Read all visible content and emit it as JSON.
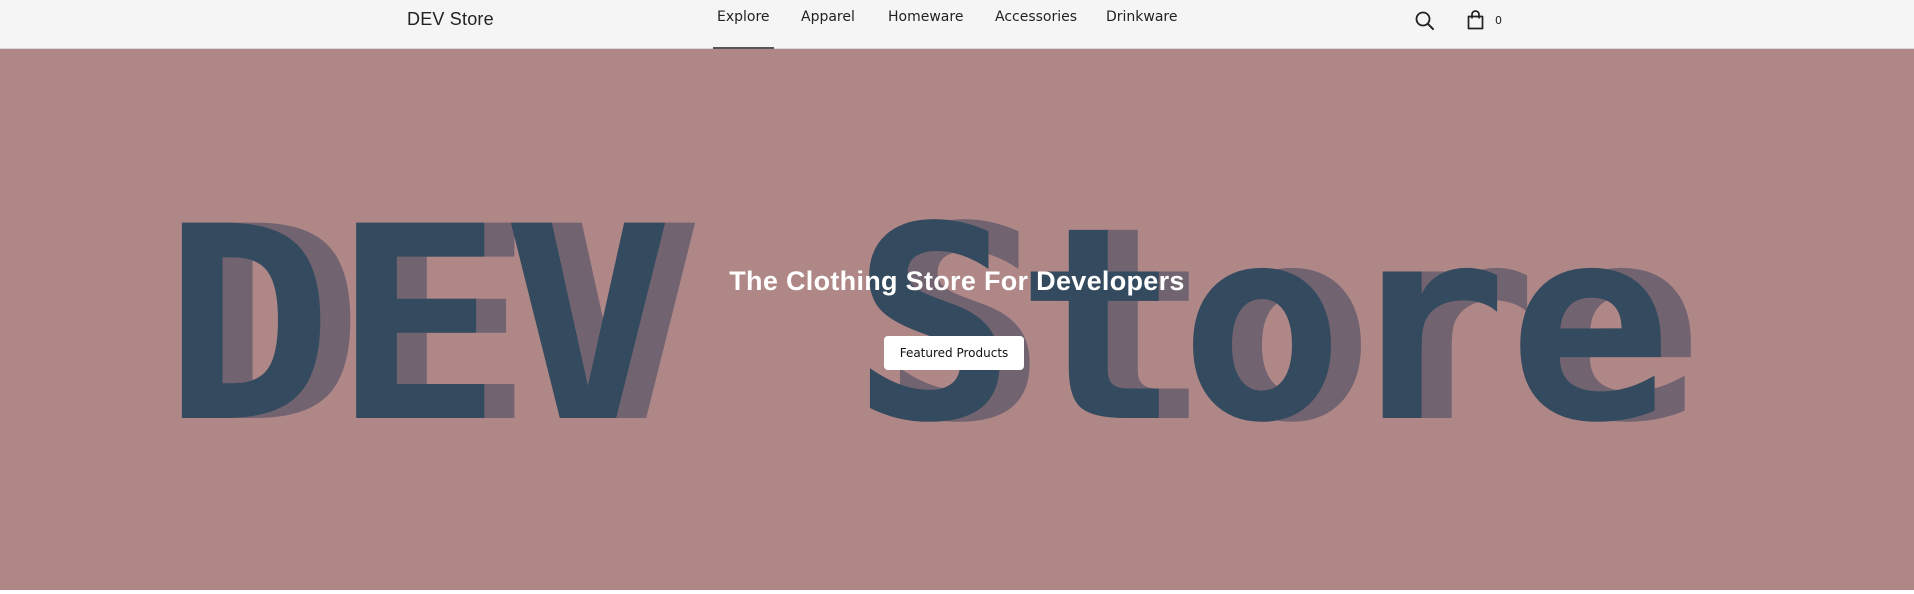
{
  "header": {
    "brand": "DEV Store",
    "nav": [
      {
        "label": "Explore",
        "active": true
      },
      {
        "label": "Apparel",
        "active": false
      },
      {
        "label": "Homeware",
        "active": false
      },
      {
        "label": "Accessories",
        "active": false
      },
      {
        "label": "Drinkware",
        "active": false
      }
    ],
    "search_icon": "search-icon",
    "cart_icon": "shopping-bag-icon",
    "cart_count": "0"
  },
  "hero": {
    "background_color": "#af8787",
    "art_text_color": "#344a5e",
    "art_shadow_color": "#716470",
    "art_words": [
      "DEV",
      "Store"
    ],
    "title": "The Clothing Store For Developers",
    "button_label": "Featured Products"
  }
}
